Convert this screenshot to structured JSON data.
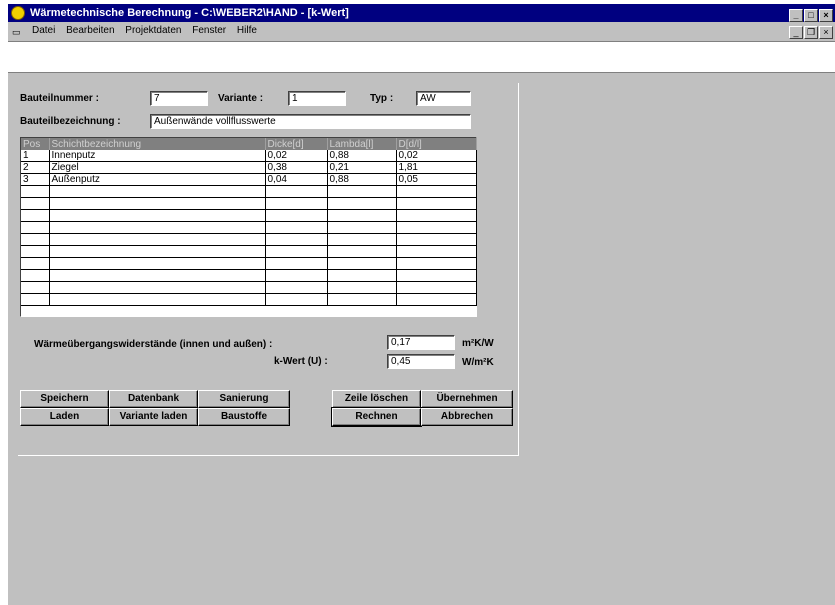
{
  "window": {
    "title": "Wärmetechnische Berechnung - C:\\WEBER2\\HAND - [k-Wert]",
    "menu": [
      "Datei",
      "Bearbeiten",
      "Projektdaten",
      "Fenster",
      "Hilfe"
    ]
  },
  "form": {
    "bauteilnummer_label": "Bauteilnummer :",
    "bauteilnummer_value": "7",
    "variante_label": "Variante :",
    "variante_value": "1",
    "typ_label": "Typ :",
    "typ_value": "AW",
    "bezeichnung_label": "Bauteilbezeichnung :",
    "bezeichnung_value": "Außenwände vollflusswerte"
  },
  "grid": {
    "columns": [
      "Pos",
      "Schichtbezeichnung",
      "Dicke[d]",
      "Lambda[l]",
      "D[d/l]"
    ],
    "rows": [
      [
        "1",
        "Innenputz",
        "0,02",
        "0,88",
        "0,02"
      ],
      [
        "2",
        "Ziegel",
        "0,38",
        "0,21",
        "1,81"
      ],
      [
        "3",
        "Außenputz",
        "0,04",
        "0,88",
        "0,05"
      ]
    ],
    "empty_rows": 10
  },
  "results": {
    "resistance_label": "Wärmeübergangswiderstände (innen und außen) :",
    "resistance_value": "0,17",
    "resistance_unit": "m²K/W",
    "kwert_label": "k-Wert (U) :",
    "kwert_value": "0,45",
    "kwert_unit": "W/m²K"
  },
  "buttons": {
    "speichern": "Speichern",
    "datenbank": "Datenbank",
    "sanierung": "Sanierung",
    "laden": "Laden",
    "variante_laden": "Variante laden",
    "baustoffe": "Baustoffe",
    "zeile_loeschen": "Zeile löschen",
    "uebernehmen": "Übernehmen",
    "rechnen": "Rechnen",
    "abbrechen": "Abbrechen"
  }
}
